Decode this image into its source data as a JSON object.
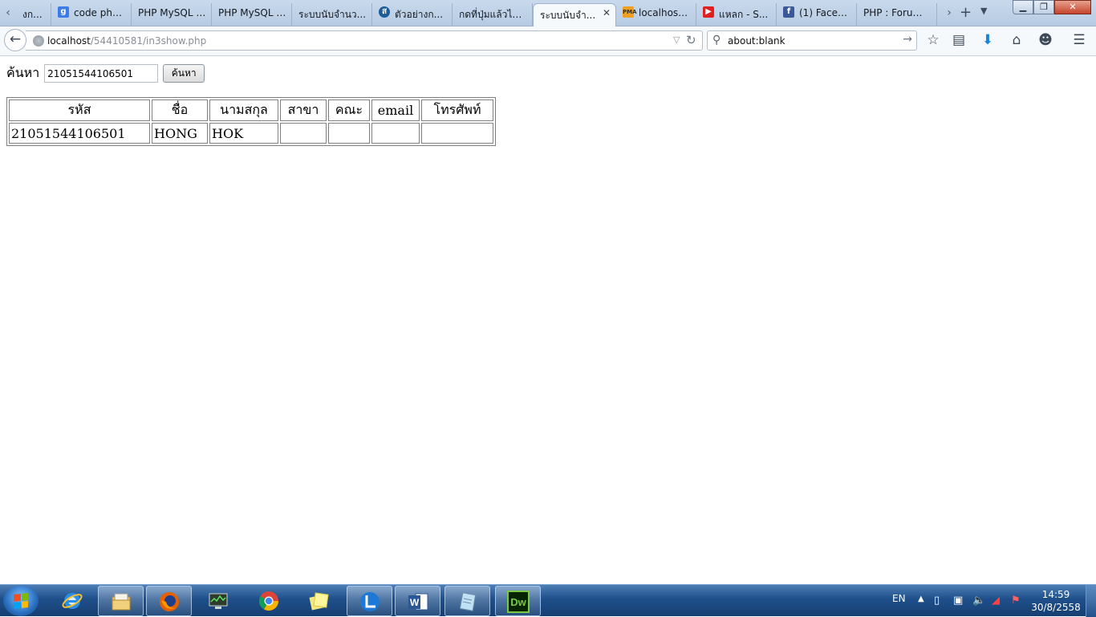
{
  "browser": {
    "tabs": [
      {
        "label": "งก...",
        "favicon": "none",
        "active": false
      },
      {
        "label": "code php...",
        "favicon": "google-icon",
        "active": false
      },
      {
        "label": "PHP MySQL S...",
        "favicon": "none",
        "active": false
      },
      {
        "label": "PHP MySQL S...",
        "favicon": "none",
        "active": false
      },
      {
        "label": "ระบบนับจำนว...",
        "favicon": "none",
        "active": false
      },
      {
        "label": "ตัวอย่างก...",
        "favicon": "site-icon",
        "active": false
      },
      {
        "label": "กดที่ปุ่มแล้วไป...",
        "favicon": "none",
        "active": false
      },
      {
        "label": "ระบบนับจำ...",
        "favicon": "none",
        "active": true
      },
      {
        "label": "localhost ...",
        "favicon": "phpmyadmin-icon",
        "active": false
      },
      {
        "label": "แหลก - S...",
        "favicon": "youtube-icon",
        "active": false
      },
      {
        "label": "(1) Faceb...",
        "favicon": "facebook-icon",
        "active": false
      },
      {
        "label": "PHP : Forum ...",
        "favicon": "none",
        "active": false
      }
    ],
    "url_host": "localhost",
    "url_path": "/54410581/in3show.php",
    "search_value": "about:blank"
  },
  "page": {
    "search_label": "ค้นหา",
    "search_value": "21051544106501",
    "search_button": "ค้นหา",
    "table": {
      "headers": [
        "รหัส",
        "ชื่อ",
        "นามสกุล",
        "สาขา",
        "คณะ",
        "email",
        "โทรศัพท์"
      ],
      "rows": [
        [
          "21051544106501",
          "HONG",
          "HOK",
          "",
          "",
          "",
          ""
        ]
      ]
    }
  },
  "taskbar": {
    "language": "EN",
    "time": "14:59",
    "date": "30/8/2558",
    "apps": [
      "internet-explorer",
      "file-explorer",
      "firefox",
      "system-monitor",
      "chrome",
      "sticky-notes",
      "app-l",
      "word",
      "notepad",
      "dreamweaver"
    ],
    "dreamweaver_label": "Dw"
  }
}
